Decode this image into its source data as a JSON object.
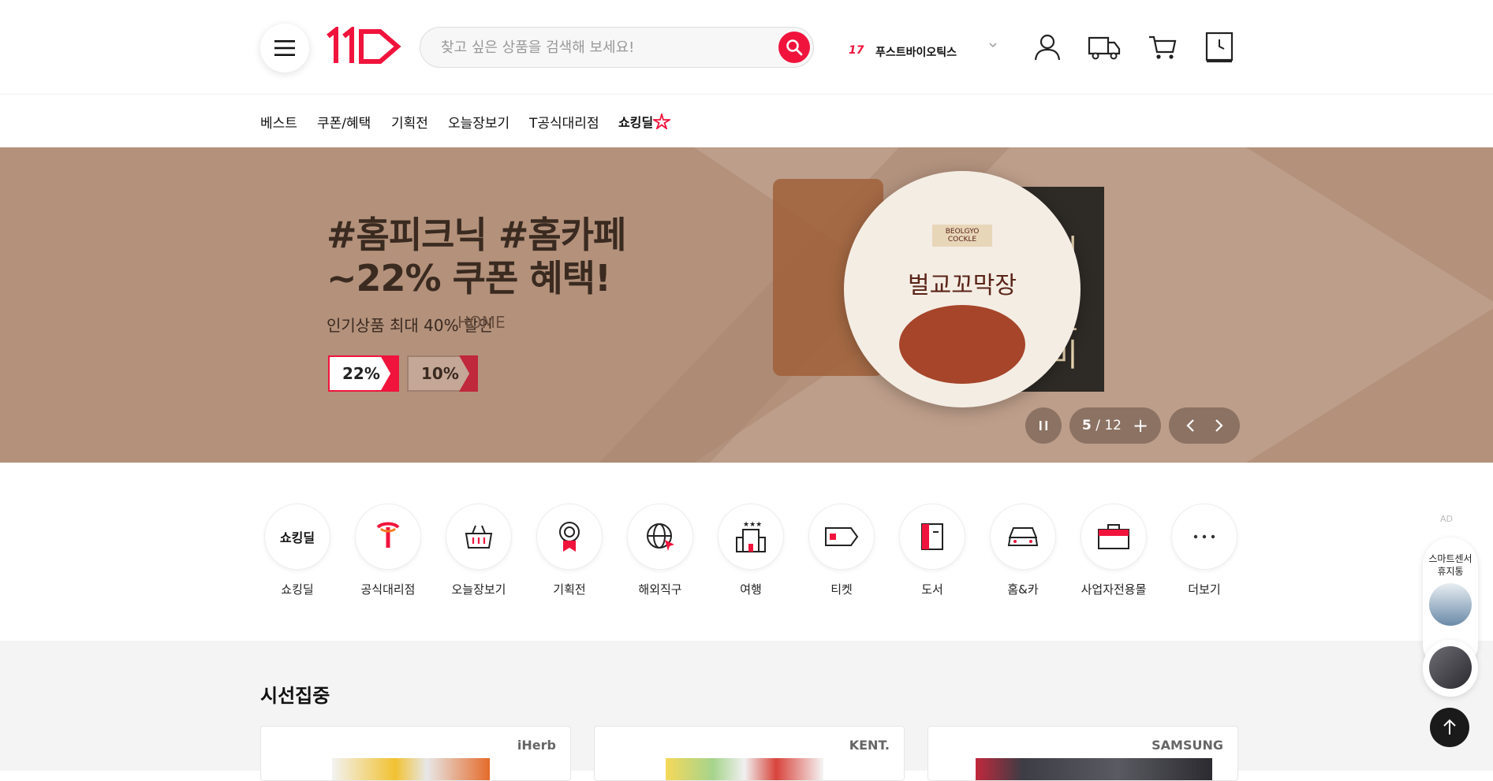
{
  "header": {
    "search_placeholder": "찾고 싶은 상품을 검색해 보세요!",
    "ranking": {
      "number": "17",
      "keyword": "푸스트바이오틱스"
    }
  },
  "nav": {
    "items": [
      "베스트",
      "쿠폰/혜택",
      "기획전",
      "오늘장보기",
      "T공식대리점",
      "쇼킹딜"
    ]
  },
  "hero": {
    "title_line1": "#홈피크닉 #홈카페",
    "title_line2": "~22% 쿠폰 혜택!",
    "subtitle": "인기상품 최대 40% 할인",
    "subtitle2": "HOME",
    "coupon1": "22%",
    "coupon2": "10%",
    "product_name": "벌교꼬막장",
    "product_brand": "BEOLGYO COCKLE",
    "box_text": "더포르미",
    "current_slide": "5",
    "total_slides": "/ 12"
  },
  "categories": [
    {
      "label": "쇼킹딜",
      "icon": "shocking-deal-icon"
    },
    {
      "label": "공식대리점",
      "icon": "t-agency-icon"
    },
    {
      "label": "오늘장보기",
      "icon": "basket-icon"
    },
    {
      "label": "기획전",
      "icon": "medal-icon"
    },
    {
      "label": "해외직구",
      "icon": "globe-icon"
    },
    {
      "label": "여행",
      "icon": "hotel-icon"
    },
    {
      "label": "티켓",
      "icon": "ticket-icon"
    },
    {
      "label": "도서",
      "icon": "book-icon"
    },
    {
      "label": "홈&카",
      "icon": "car-icon"
    },
    {
      "label": "사업자전용몰",
      "icon": "briefcase-icon"
    },
    {
      "label": "더보기",
      "icon": "more-icon"
    }
  ],
  "section": {
    "title": "시선집중",
    "cards": [
      {
        "brand": "iHerb"
      },
      {
        "brand": "KENT."
      },
      {
        "brand": "SAMSUNG"
      }
    ]
  },
  "side": {
    "ad_label": "AD",
    "item_text": "스마트센서 휴지통"
  },
  "colors": {
    "accent": "#f0143c",
    "hero_bg": "#b3917b",
    "section_bg": "#f4f4f5"
  }
}
